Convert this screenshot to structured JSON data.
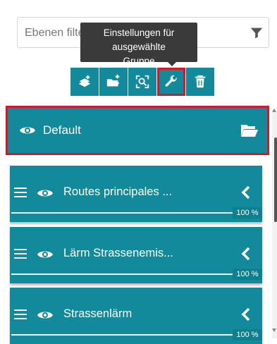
{
  "filter": {
    "placeholder": "Ebenen filtern"
  },
  "tooltip": {
    "line1": "Einstellungen für ausgewählte",
    "line2": "Gruppe"
  },
  "toolbar": {
    "buttons": [
      {
        "name": "add-layer",
        "icon": "add-layer-icon"
      },
      {
        "name": "add-group",
        "icon": "add-folder-icon"
      },
      {
        "name": "zoom-to",
        "icon": "zoom-extent-icon"
      },
      {
        "name": "group-settings",
        "icon": "wrench-icon",
        "selected": true
      },
      {
        "name": "delete",
        "icon": "trash-icon"
      }
    ]
  },
  "group": {
    "label": "Default",
    "visible": true,
    "selected": true
  },
  "layers": [
    {
      "label": "Routes principales ...",
      "visible": true,
      "opacity": "100 %"
    },
    {
      "label": "Lärm Strassenemis...",
      "visible": true,
      "opacity": "100 %"
    },
    {
      "label": "Strassenlärm",
      "visible": true,
      "opacity": "100 %"
    }
  ],
  "colors": {
    "accent": "#128a9b",
    "highlight": "#d4182a",
    "tooltip_bg": "#3a3a3a"
  }
}
